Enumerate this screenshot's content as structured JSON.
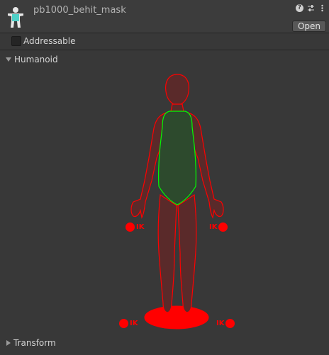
{
  "header": {
    "title": "pb1000_behit_mask",
    "open_label": "Open"
  },
  "addressable": {
    "label": "Addressable",
    "checked": false
  },
  "sections": {
    "humanoid": {
      "label": "Humanoid",
      "expanded": true
    },
    "transform": {
      "label": "Transform",
      "expanded": false
    }
  },
  "ik": {
    "left_hand": "IK",
    "right_hand": "IK",
    "left_foot": "IK",
    "right_foot": "IK"
  },
  "colors": {
    "disabled_part": "#ff0000",
    "enabled_part": "#00ff00",
    "panel_bg": "#383838"
  },
  "mask_state": {
    "body": "enabled",
    "head": "disabled",
    "left_arm": "disabled",
    "right_arm": "disabled",
    "left_leg": "disabled",
    "right_leg": "disabled",
    "root": "disabled",
    "left_hand_ik": "disabled",
    "right_hand_ik": "disabled",
    "left_foot_ik": "disabled",
    "right_foot_ik": "disabled"
  }
}
